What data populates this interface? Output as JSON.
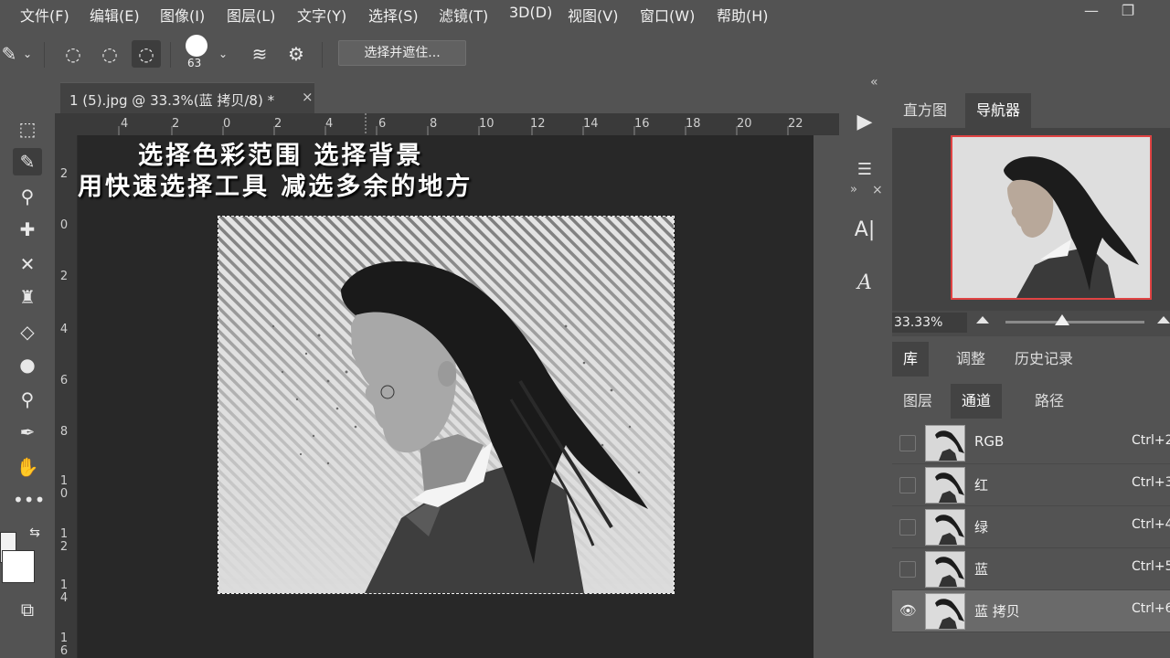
{
  "menu": {
    "items": [
      "文件(F)",
      "编辑(E)",
      "图像(I)",
      "图层(L)",
      "文字(Y)",
      "选择(S)",
      "滤镜(T)",
      "3D(D)",
      "视图(V)",
      "窗口(W)",
      "帮助(H)"
    ]
  },
  "options": {
    "brush_size": "63",
    "refine_label": "选择并遮住..."
  },
  "document": {
    "tab_title": "1 (5).jpg @ 33.3%(蓝 拷贝/8) *",
    "close_glyph": "×",
    "overlay_line1": "选择色彩范围 选择背景",
    "overlay_line2": "用快速选择工具 减选多余的地方"
  },
  "rulers": {
    "top": [
      "4",
      "2",
      "0",
      "2",
      "4",
      "6",
      "8",
      "10",
      "12",
      "14",
      "16",
      "18",
      "20",
      "22"
    ],
    "left": [
      "2",
      "0",
      "2",
      "4",
      "6",
      "8",
      "1\n0",
      "1\n2",
      "1\n4",
      "1\n6"
    ]
  },
  "panels": {
    "nav_tabs": [
      "直方图",
      "导航器"
    ],
    "zoom": "33.33%",
    "lib_tabs": [
      "库",
      "调整",
      "历史记录"
    ],
    "layer_tabs": [
      "图层",
      "通道",
      "路径"
    ],
    "channels": [
      {
        "name": "RGB",
        "key": "Ctrl+2",
        "visible": false
      },
      {
        "name": "红",
        "key": "Ctrl+3",
        "visible": false
      },
      {
        "name": "绿",
        "key": "Ctrl+4",
        "visible": false
      },
      {
        "name": "蓝",
        "key": "Ctrl+5",
        "visible": false
      },
      {
        "name": "蓝 拷贝",
        "key": "Ctrl+6",
        "visible": true
      }
    ]
  },
  "mini_dock": {
    "collapse": "«",
    "expand": "»",
    "close": "×"
  },
  "colors": {
    "ui_bg": "#535353",
    "canvas_bg": "#282828",
    "nav_frame": "#e04343"
  }
}
